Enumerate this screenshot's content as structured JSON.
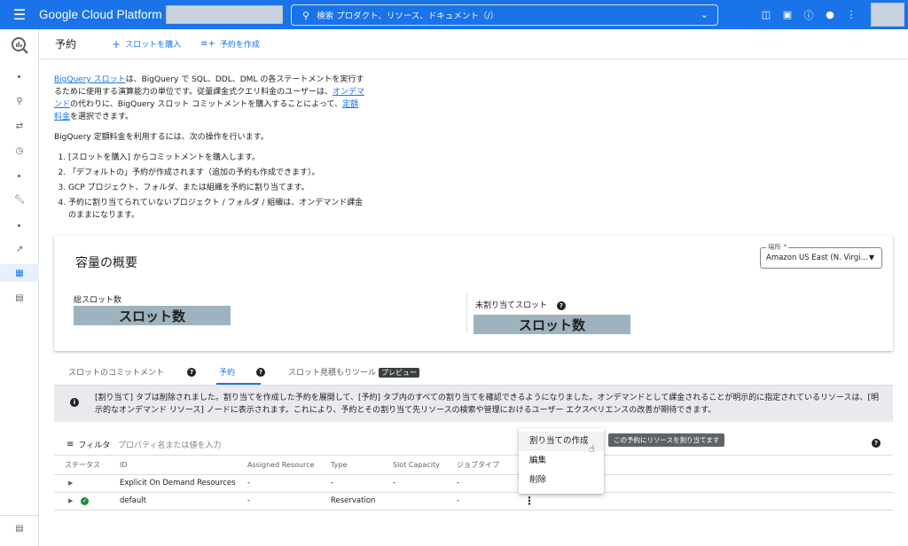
{
  "topbar": {
    "brand": "Google Cloud Platform",
    "search_placeholder": "検索  プロダクト、リソース、ドキュメント（/）"
  },
  "subheader": {
    "title": "予約",
    "buy_slots": "スロットを購入",
    "create_reservation": "予約を作成"
  },
  "intro": {
    "link_slots": "BigQuery スロット",
    "p1_a": "は、BigQuery で SQL、DDL、DML の各ステートメントを実行するために使用する演算能力の単位です。従量課金式クエリ料金のユーザーは、",
    "link_ondemand": "オンデマンド",
    "p1_b": "の代わりに、BigQuery スロット コミットメントを購入することによって、",
    "link_flat": "定額料金",
    "p1_c": "を選択できます。",
    "p2": "BigQuery 定額料金を利用するには、次の操作を行います。",
    "steps": [
      "[スロットを購入] からコミットメントを購入します。",
      "「デフォルトの」予約が作成されます（追加の予約も作成できます）。",
      "GCP プロジェクト、フォルダ、または組織を予約に割り当てます。",
      "予約に割り当てられていないプロジェクト / フォルダ / 組織は、オンデマンド課金のままになります。"
    ]
  },
  "capacity": {
    "title": "容量の概要",
    "location_label": "場所 *",
    "location_value": "Amazon US East (N. Virgi...",
    "total_label": "総スロット数",
    "total_value": "スロット数",
    "unassigned_label": "未割り当てスロット",
    "unassigned_value": "スロット数"
  },
  "tabs": {
    "commitments": "スロットのコミットメント",
    "reservations": "予約",
    "estimator": "スロット見積もりツール",
    "preview": "プレビュー"
  },
  "info": {
    "text": "[割り当て] タブは削除されました。割り当てを作成した予約を展開して、[予約] タブ内のすべての割り当てを確認できるようになりました。オンデマンドとして課金されることが明示的に指定されているリソースは、[明示的なオンデマンド リソース] ノードに表示されます。これにより、予約とその割り当て先リソースの検索や管理におけるユーザー エクスペリエンスの改善が期待できます。"
  },
  "filter": {
    "label": "フィルタ",
    "placeholder": "プロパティ名または値を入力"
  },
  "table": {
    "headers": [
      "ステータス",
      "ID",
      "Assigned Resource",
      "Type",
      "Slot Capacity",
      "ジョブタイプ"
    ],
    "rows": [
      {
        "id": "Explicit On Demand Resources",
        "assigned": "-",
        "type": "-",
        "slots": "-",
        "job": "-"
      },
      {
        "id": "default",
        "assigned": "-",
        "type": "Reservation",
        "slots": "",
        "job": "-"
      }
    ]
  },
  "menu": {
    "items": [
      "割り当ての作成",
      "編集",
      "削除"
    ],
    "tooltip": "この予約にリソースを割り当てます"
  }
}
